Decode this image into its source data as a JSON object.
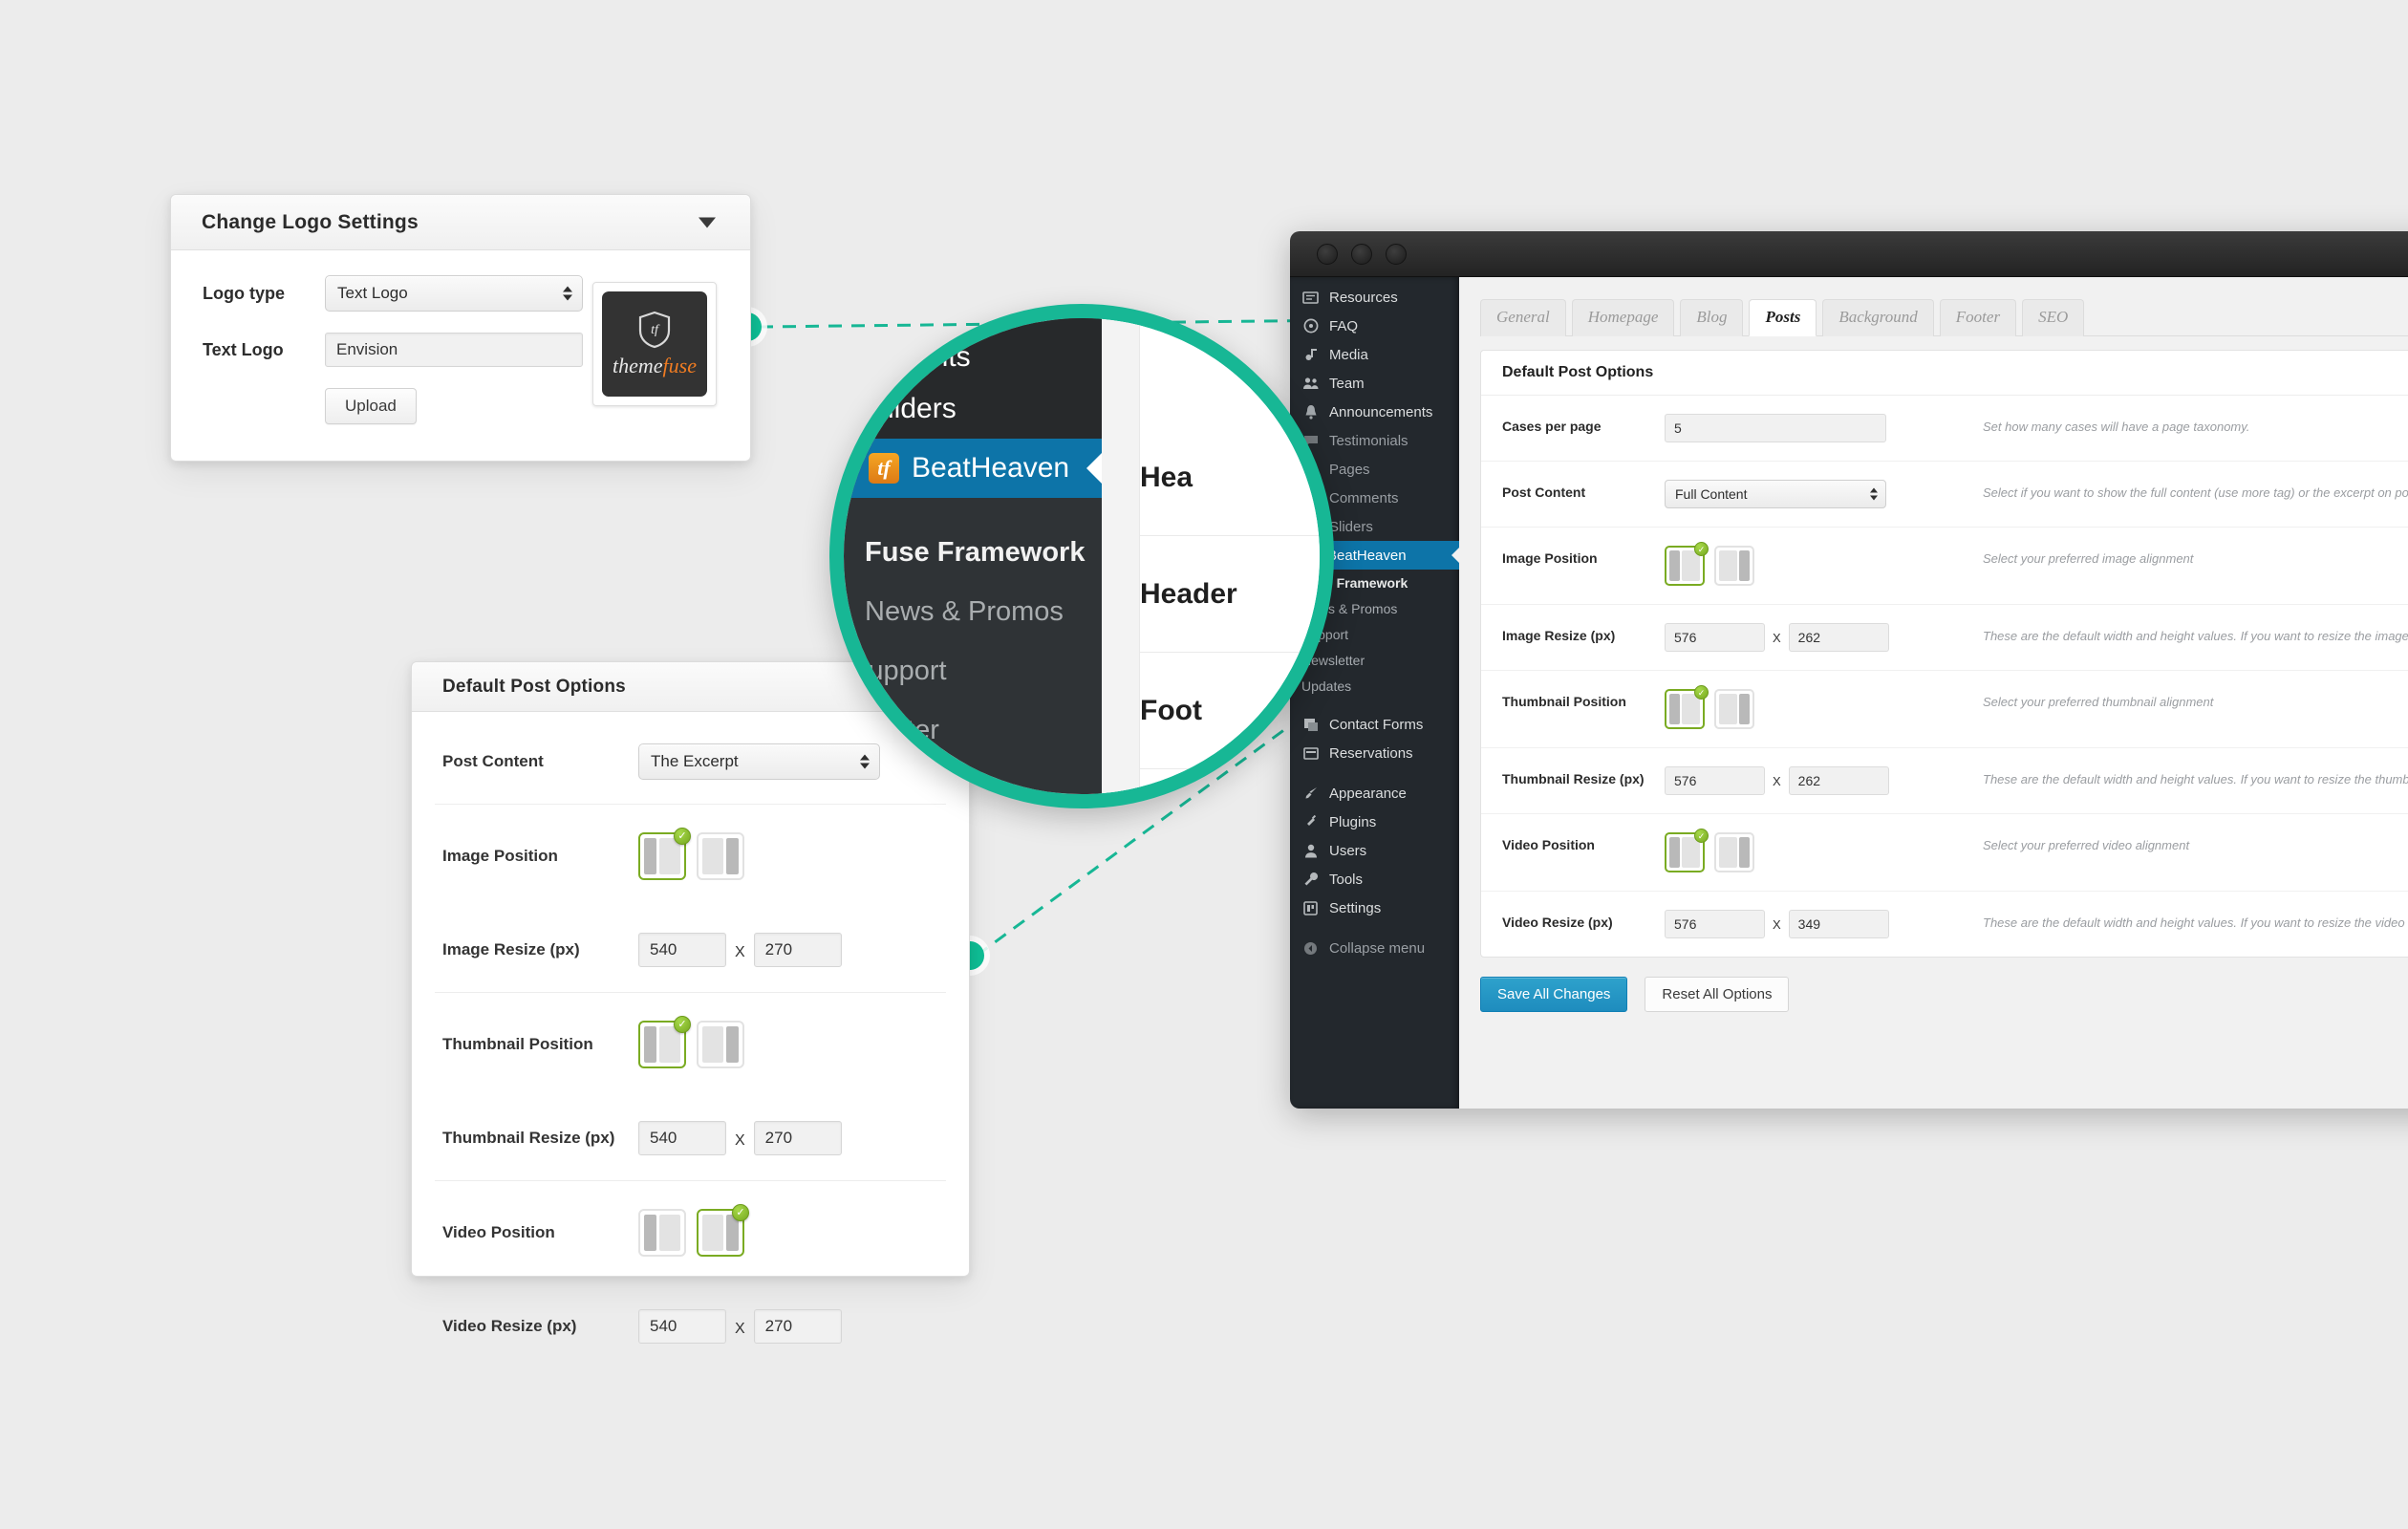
{
  "logo_panel": {
    "title": "Change Logo Settings",
    "collapse_icon": "chevron-down-icon",
    "logo_type_label": "Logo type",
    "logo_type_value": "Text Logo",
    "text_logo_label": "Text Logo",
    "text_logo_value": "Envision",
    "upload_label": "Upload",
    "thumb": {
      "brand_a": "theme",
      "brand_b": "fuse",
      "monogram": "tf"
    }
  },
  "post_panel": {
    "title": "Default Post Options",
    "rows": [
      {
        "label": "Post Content",
        "value": "The Excerpt",
        "type": "select"
      },
      {
        "label": "Image Position",
        "type": "tiles",
        "selected": 0
      },
      {
        "label": "Image Resize (px)",
        "w": "540",
        "h": "270",
        "x": "X",
        "type": "size"
      },
      {
        "label": "Thumbnail Position",
        "type": "tiles",
        "selected": 0
      },
      {
        "label": "Thumbnail Resize (px)",
        "w": "540",
        "h": "270",
        "x": "X",
        "type": "size"
      },
      {
        "label": "Video Position",
        "type": "tiles",
        "selected": 1
      },
      {
        "label": "Video Resize (px)",
        "w": "540",
        "h": "270",
        "x": "X",
        "type": "size"
      }
    ]
  },
  "wp_window": {
    "traffic_lights": [
      "window-dot-1",
      "window-dot-2",
      "window-dot-3"
    ],
    "sidebar": {
      "items": [
        {
          "label": "Resources",
          "icon": "resources-icon",
          "state": "normal"
        },
        {
          "label": "FAQ",
          "icon": "faq-icon",
          "state": "normal"
        },
        {
          "label": "Media",
          "icon": "media-icon",
          "state": "normal"
        },
        {
          "label": "Team",
          "icon": "team-icon",
          "state": "normal"
        },
        {
          "label": "Announcements",
          "icon": "announcements-icon",
          "state": "normal"
        },
        {
          "label": "Testimonials",
          "icon": "testimonials-icon",
          "state": "dim"
        },
        {
          "label": "Pages",
          "icon": "pages-icon",
          "state": "dim"
        },
        {
          "label": "Comments",
          "icon": "comments-icon",
          "state": "dim"
        },
        {
          "label": "Sliders",
          "icon": "sliders-icon",
          "state": "dim"
        },
        {
          "label": "BeatHeaven",
          "icon": "themefuse-badge-icon",
          "state": "active"
        }
      ],
      "subitems": [
        {
          "label": "Fuse Framework",
          "bold": true
        },
        {
          "label": "News & Promos",
          "bold": false
        },
        {
          "label": "Support",
          "bold": false
        },
        {
          "label": "Newsletter",
          "bold": false
        },
        {
          "label": "Updates",
          "bold": false
        }
      ],
      "items2": [
        {
          "label": "Contact Forms",
          "icon": "contact-forms-icon"
        },
        {
          "label": "Reservations",
          "icon": "reservations-icon"
        }
      ],
      "items3": [
        {
          "label": "Appearance",
          "icon": "paintbrush-icon"
        },
        {
          "label": "Plugins",
          "icon": "plug-icon"
        },
        {
          "label": "Users",
          "icon": "user-icon"
        },
        {
          "label": "Tools",
          "icon": "wrench-icon"
        },
        {
          "label": "Settings",
          "icon": "settings-icon"
        }
      ],
      "collapse": {
        "label": "Collapse menu",
        "icon": "collapse-arrow-icon"
      }
    },
    "tabs": [
      {
        "label": "General",
        "active": false
      },
      {
        "label": "Homepage",
        "active": false
      },
      {
        "label": "Blog",
        "active": false
      },
      {
        "label": "Posts",
        "active": true
      },
      {
        "label": "Background",
        "active": false
      },
      {
        "label": "Footer",
        "active": false
      },
      {
        "label": "SEO",
        "active": false
      }
    ],
    "card_title": "Default Post Options",
    "rows": [
      {
        "label": "Cases per page",
        "type": "input",
        "value": "5",
        "desc": "Set how many cases will have a page taxonomy."
      },
      {
        "label": "Post Content",
        "type": "select",
        "value": "Full Content",
        "desc": "Select if you want to show the full content (use more tag) or the excerpt on posts listing."
      },
      {
        "label": "Image Position",
        "type": "tiles",
        "selected": 0,
        "desc": "Select your preferred image alignment"
      },
      {
        "label": "Image Resize (px)",
        "type": "size",
        "w": "576",
        "h": "262",
        "x": "X",
        "desc": "These are the default width and height values. If you want to resize the image change the values specified."
      },
      {
        "label": "Thumbnail Position",
        "type": "tiles",
        "selected": 0,
        "desc": "Select your preferred thumbnail alignment"
      },
      {
        "label": "Thumbnail Resize (px)",
        "type": "size",
        "w": "576",
        "h": "262",
        "x": "X",
        "desc": "These are the default width and height values. If you want to resize the thumbnail change the values specified."
      },
      {
        "label": "Video Position",
        "type": "tiles",
        "selected": 0,
        "desc": "Select your preferred video alignment"
      },
      {
        "label": "Video Resize (px)",
        "type": "size",
        "w": "576",
        "h": "349",
        "x": "X",
        "desc": "These are the default width and height values. If you want to resize the video change the values specified."
      }
    ],
    "save_label": "Save All Changes",
    "reset_label": "Reset All Options"
  },
  "magnifier": {
    "menu": [
      {
        "label": "mments",
        "state": "clipped"
      },
      {
        "label": "Sliders",
        "state": "normal"
      },
      {
        "label": "BeatHeaven",
        "state": "active",
        "icon": "themefuse-badge-icon"
      }
    ],
    "submenu": [
      {
        "label": "Fuse Framework",
        "bold": true
      },
      {
        "label": "News & Promos",
        "bold": false
      },
      {
        "label": "Support",
        "bold": false
      },
      {
        "label": "wsletter",
        "bold": false
      },
      {
        "label": "es",
        "bold": false
      }
    ],
    "right_rows": [
      "Hea",
      "Header",
      "Foot"
    ]
  },
  "colors": {
    "accent_teal": "#17b795",
    "dot_teal": "#0fbe95",
    "wp_active_blue": "#0d74a8",
    "save_blue": "#1e8cbe",
    "tile_green": "#7aab22",
    "brand_orange": "#f07c22"
  }
}
